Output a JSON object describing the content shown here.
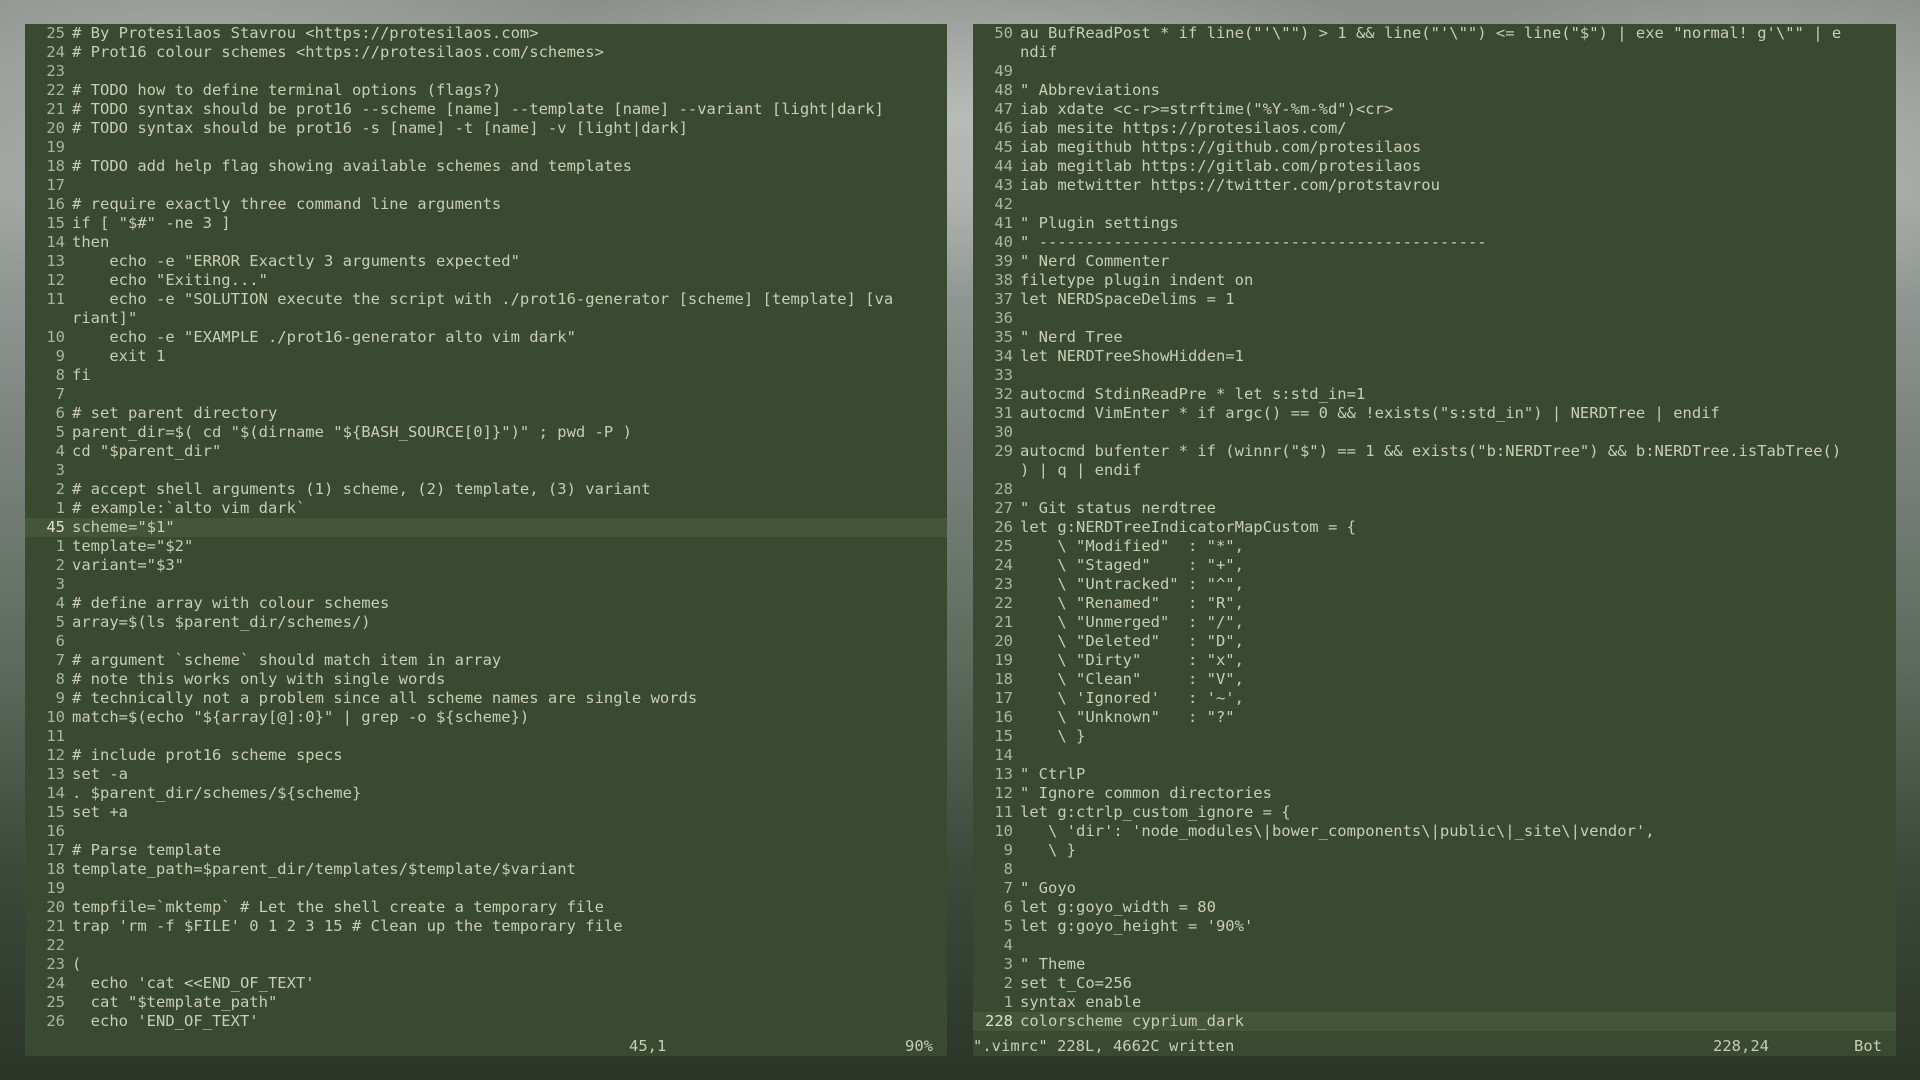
{
  "left_pane": {
    "lines": [
      {
        "n": "25",
        "t": "# By Protesilaos Stavrou <https://protesilaos.com>"
      },
      {
        "n": "24",
        "t": "# Prot16 colour schemes <https://protesilaos.com/schemes>"
      },
      {
        "n": "23",
        "t": ""
      },
      {
        "n": "22",
        "t": "# TODO how to define terminal options (flags?)"
      },
      {
        "n": "21",
        "t": "# TODO syntax should be prot16 --scheme [name] --template [name] --variant [light|dark]"
      },
      {
        "n": "20",
        "t": "# TODO syntax should be prot16 -s [name] -t [name] -v [light|dark]"
      },
      {
        "n": "19",
        "t": ""
      },
      {
        "n": "18",
        "t": "# TODO add help flag showing available schemes and templates"
      },
      {
        "n": "17",
        "t": ""
      },
      {
        "n": "16",
        "t": "# require exactly three command line arguments"
      },
      {
        "n": "15",
        "t": "if [ \"$#\" -ne 3 ]"
      },
      {
        "n": "14",
        "t": "then"
      },
      {
        "n": "13",
        "t": "    echo -e \"ERROR Exactly 3 arguments expected\""
      },
      {
        "n": "12",
        "t": "    echo \"Exiting...\""
      },
      {
        "n": "11",
        "t": "    echo -e \"SOLUTION execute the script with ./prot16-generator [scheme] [template] [va"
      },
      {
        "n": "",
        "t": "riant]\""
      },
      {
        "n": "10",
        "t": "    echo -e \"EXAMPLE ./prot16-generator alto vim dark\""
      },
      {
        "n": "9",
        "t": "    exit 1"
      },
      {
        "n": "8",
        "t": "fi"
      },
      {
        "n": "7",
        "t": ""
      },
      {
        "n": "6",
        "t": "# set parent directory"
      },
      {
        "n": "5",
        "t": "parent_dir=$( cd \"$(dirname \"${BASH_SOURCE[0]}\")\" ; pwd -P )"
      },
      {
        "n": "4",
        "t": "cd \"$parent_dir\""
      },
      {
        "n": "3",
        "t": ""
      },
      {
        "n": "2",
        "t": "# accept shell arguments (1) scheme, (2) template, (3) variant"
      },
      {
        "n": "1",
        "t": "# example:`alto vim dark`"
      },
      {
        "n": "45",
        "t": "scheme=\"$1\"",
        "current": true
      },
      {
        "n": "1",
        "t": "template=\"$2\""
      },
      {
        "n": "2",
        "t": "variant=\"$3\""
      },
      {
        "n": "3",
        "t": ""
      },
      {
        "n": "4",
        "t": "# define array with colour schemes"
      },
      {
        "n": "5",
        "t": "array=$(ls $parent_dir/schemes/)"
      },
      {
        "n": "6",
        "t": ""
      },
      {
        "n": "7",
        "t": "# argument `scheme` should match item in array"
      },
      {
        "n": "8",
        "t": "# note this works only with single words"
      },
      {
        "n": "9",
        "t": "# technically not a problem since all scheme names are single words"
      },
      {
        "n": "10",
        "t": "match=$(echo \"${array[@]:0}\" | grep -o ${scheme})"
      },
      {
        "n": "11",
        "t": ""
      },
      {
        "n": "12",
        "t": "# include prot16 scheme specs"
      },
      {
        "n": "13",
        "t": "set -a"
      },
      {
        "n": "14",
        "t": ". $parent_dir/schemes/${scheme}"
      },
      {
        "n": "15",
        "t": "set +a"
      },
      {
        "n": "16",
        "t": ""
      },
      {
        "n": "17",
        "t": "# Parse template"
      },
      {
        "n": "18",
        "t": "template_path=$parent_dir/templates/$template/$variant"
      },
      {
        "n": "19",
        "t": ""
      },
      {
        "n": "20",
        "t": "tempfile=`mktemp` # Let the shell create a temporary file"
      },
      {
        "n": "21",
        "t": "trap 'rm -f $FILE' 0 1 2 3 15 # Clean up the temporary file"
      },
      {
        "n": "22",
        "t": ""
      },
      {
        "n": "23",
        "t": "("
      },
      {
        "n": "24",
        "t": "  echo 'cat <<END_OF_TEXT'"
      },
      {
        "n": "25",
        "t": "  cat \"$template_path\""
      },
      {
        "n": "26",
        "t": "  echo 'END_OF_TEXT'"
      }
    ],
    "status_pos": "45,1",
    "status_pct": "90%"
  },
  "right_pane": {
    "lines": [
      {
        "n": "50",
        "t": "au BufReadPost * if line(\"'\\\"\") > 1 && line(\"'\\\"\") <= line(\"$\") | exe \"normal! g'\\\"\" | e"
      },
      {
        "n": "",
        "t": "ndif"
      },
      {
        "n": "49",
        "t": ""
      },
      {
        "n": "48",
        "t": "\" Abbreviations"
      },
      {
        "n": "47",
        "t": "iab xdate <c-r>=strftime(\"%Y-%m-%d\")<cr>"
      },
      {
        "n": "46",
        "t": "iab mesite https://protesilaos.com/"
      },
      {
        "n": "45",
        "t": "iab megithub https://github.com/protesilaos"
      },
      {
        "n": "44",
        "t": "iab megitlab https://gitlab.com/protesilaos"
      },
      {
        "n": "43",
        "t": "iab metwitter https://twitter.com/protstavrou"
      },
      {
        "n": "42",
        "t": ""
      },
      {
        "n": "41",
        "t": "\" Plugin settings"
      },
      {
        "n": "40",
        "t": "\" ------------------------------------------------"
      },
      {
        "n": "39",
        "t": "\" Nerd Commenter"
      },
      {
        "n": "38",
        "t": "filetype plugin indent on"
      },
      {
        "n": "37",
        "t": "let NERDSpaceDelims = 1"
      },
      {
        "n": "36",
        "t": ""
      },
      {
        "n": "35",
        "t": "\" Nerd Tree"
      },
      {
        "n": "34",
        "t": "let NERDTreeShowHidden=1"
      },
      {
        "n": "33",
        "t": ""
      },
      {
        "n": "32",
        "t": "autocmd StdinReadPre * let s:std_in=1"
      },
      {
        "n": "31",
        "t": "autocmd VimEnter * if argc() == 0 && !exists(\"s:std_in\") | NERDTree | endif"
      },
      {
        "n": "30",
        "t": ""
      },
      {
        "n": "29",
        "t": "autocmd bufenter * if (winnr(\"$\") == 1 && exists(\"b:NERDTree\") && b:NERDTree.isTabTree()"
      },
      {
        "n": "",
        "t": ") | q | endif"
      },
      {
        "n": "28",
        "t": ""
      },
      {
        "n": "27",
        "t": "\" Git status nerdtree"
      },
      {
        "n": "26",
        "t": "let g:NERDTreeIndicatorMapCustom = {"
      },
      {
        "n": "25",
        "t": "    \\ \"Modified\"  : \"*\","
      },
      {
        "n": "24",
        "t": "    \\ \"Staged\"    : \"+\","
      },
      {
        "n": "23",
        "t": "    \\ \"Untracked\" : \"^\","
      },
      {
        "n": "22",
        "t": "    \\ \"Renamed\"   : \"R\","
      },
      {
        "n": "21",
        "t": "    \\ \"Unmerged\"  : \"/\","
      },
      {
        "n": "20",
        "t": "    \\ \"Deleted\"   : \"D\","
      },
      {
        "n": "19",
        "t": "    \\ \"Dirty\"     : \"x\","
      },
      {
        "n": "18",
        "t": "    \\ \"Clean\"     : \"V\","
      },
      {
        "n": "17",
        "t": "    \\ 'Ignored'   : '~',"
      },
      {
        "n": "16",
        "t": "    \\ \"Unknown\"   : \"?\""
      },
      {
        "n": "15",
        "t": "    \\ }"
      },
      {
        "n": "14",
        "t": ""
      },
      {
        "n": "13",
        "t": "\" CtrlP"
      },
      {
        "n": "12",
        "t": "\" Ignore common directories"
      },
      {
        "n": "11",
        "t": "let g:ctrlp_custom_ignore = {"
      },
      {
        "n": "10",
        "t": "   \\ 'dir': 'node_modules\\|bower_components\\|public\\|_site\\|vendor',"
      },
      {
        "n": "9",
        "t": "   \\ }"
      },
      {
        "n": "8",
        "t": ""
      },
      {
        "n": "7",
        "t": "\" Goyo"
      },
      {
        "n": "6",
        "t": "let g:goyo_width = 80"
      },
      {
        "n": "5",
        "t": "let g:goyo_height = '90%'"
      },
      {
        "n": "4",
        "t": ""
      },
      {
        "n": "3",
        "t": "\" Theme"
      },
      {
        "n": "2",
        "t": "set t_Co=256"
      },
      {
        "n": "1",
        "t": "syntax enable"
      },
      {
        "n": "228",
        "t": "colorscheme cyprium_dark",
        "current": true
      }
    ],
    "status_msg": "\".vimrc\" 228L, 4662C written",
    "status_pos": "228,24",
    "status_pct": "Bot"
  }
}
